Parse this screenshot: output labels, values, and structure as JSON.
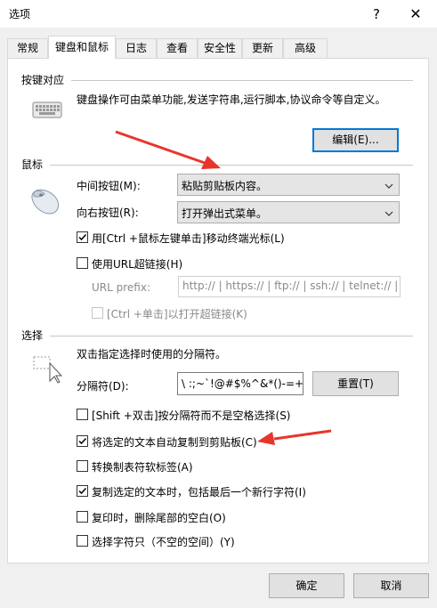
{
  "window": {
    "title": "选项",
    "help_glyph": "?",
    "close_glyph": "✕"
  },
  "tabs": [
    {
      "label": "常规",
      "active": false
    },
    {
      "label": "键盘和鼠标",
      "active": true
    },
    {
      "label": "日志",
      "active": false
    },
    {
      "label": "查看",
      "active": false
    },
    {
      "label": "安全性",
      "active": false
    },
    {
      "label": "更新",
      "active": false
    },
    {
      "label": "高级",
      "active": false
    }
  ],
  "keymap": {
    "heading": "按键对应",
    "description": "键盘操作可由菜单功能,发送字符串,运行脚本,协议命令等自定义。",
    "edit_button": "编辑(E)..."
  },
  "mouse": {
    "heading": "鼠标",
    "middle_label": "中间按钮(M):",
    "middle_value": "粘贴剪贴板内容。",
    "right_label": "向右按钮(R):",
    "right_value": "打开弹出式菜单。",
    "ctrl_click_move": {
      "label": "用[Ctrl +鼠标左键单击]移动终端光标(L)",
      "checked": true
    },
    "use_url": {
      "label": "使用URL超链接(H)",
      "checked": false
    },
    "url_prefix_label": "URL prefix:",
    "url_prefix_value": "http:// | https:// | ftp:// | ssh:// | telnet:// |",
    "ctrl_click_open": {
      "label": "[Ctrl +单击]以打开超链接(K)",
      "checked": false,
      "disabled": true
    }
  },
  "selection": {
    "heading": "选择",
    "description": "双击指定选择时使用的分隔符。",
    "delimiter_label": "分隔符(D):",
    "delimiter_value": "\\ :;~`!@#$%^&*()-=+|[",
    "reset_button": "重置(T)",
    "options": [
      {
        "label": "[Shift +双击]按分隔符而不是空格选择(S)",
        "checked": false
      },
      {
        "label": "将选定的文本自动复制到剪贴板(C)",
        "checked": true
      },
      {
        "label": "转换制表符软标签(A)",
        "checked": false
      },
      {
        "label": "复制选定的文本时，包括最后一个新行字符(I)",
        "checked": true
      },
      {
        "label": "复印时，删除尾部的空白(O)",
        "checked": false
      },
      {
        "label": "选择字符只（不空的空间）(Y)",
        "checked": false
      }
    ]
  },
  "footer": {
    "ok": "确定",
    "cancel": "取消"
  },
  "annotations": {
    "arrow_color": "#e8352b"
  }
}
